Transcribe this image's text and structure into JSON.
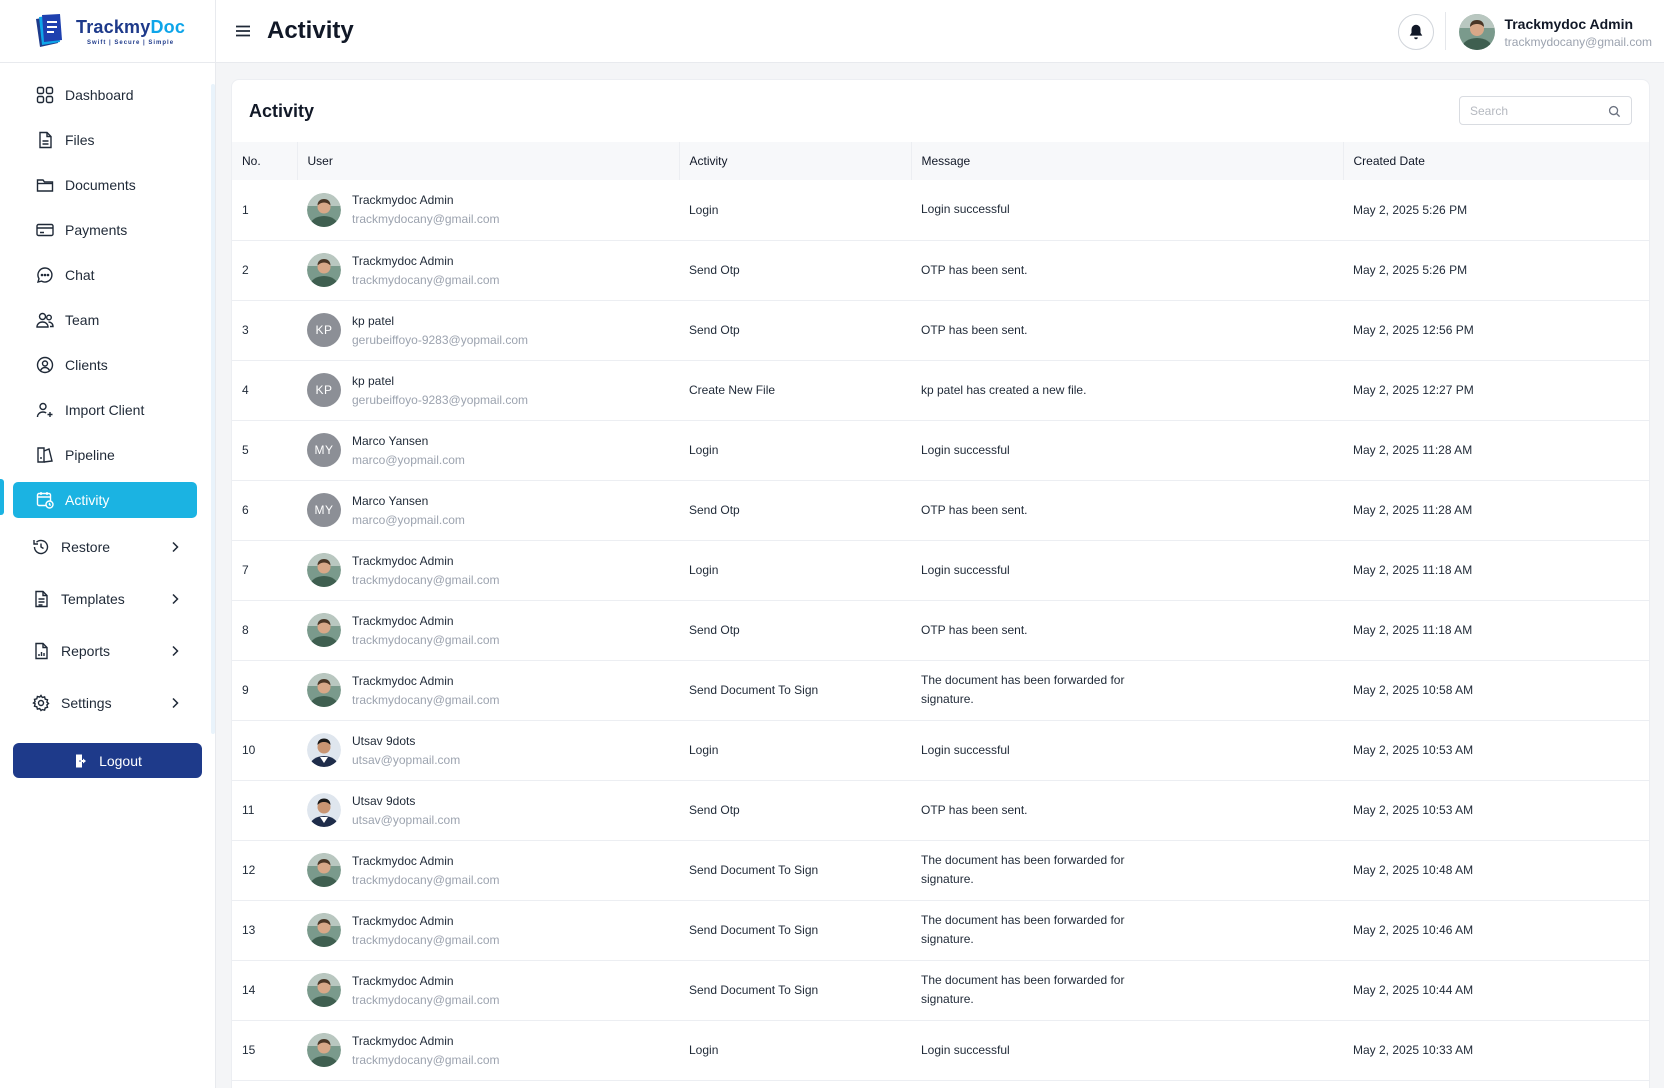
{
  "brand": {
    "name_part1": "Trackmy",
    "name_part2": "Doc",
    "tagline": "Swift | Secure | Simple"
  },
  "header": {
    "title": "Activity",
    "user_name": "Trackmydoc Admin",
    "user_email": "trackmydocany@gmail.com"
  },
  "nav": [
    {
      "label": "Dashboard",
      "icon": "grid-icon"
    },
    {
      "label": "Files",
      "icon": "file-icon"
    },
    {
      "label": "Documents",
      "icon": "folder-icon"
    },
    {
      "label": "Payments",
      "icon": "card-icon"
    },
    {
      "label": "Chat",
      "icon": "chat-icon"
    },
    {
      "label": "Team",
      "icon": "team-icon"
    },
    {
      "label": "Clients",
      "icon": "client-icon"
    },
    {
      "label": "Import Client",
      "icon": "user-add-icon"
    },
    {
      "label": "Pipeline",
      "icon": "pipeline-icon"
    },
    {
      "label": "Activity",
      "icon": "calendar-clock-icon",
      "active": true
    }
  ],
  "nav_groups": [
    {
      "label": "Restore",
      "icon": "history-icon"
    },
    {
      "label": "Templates",
      "icon": "template-icon"
    },
    {
      "label": "Reports",
      "icon": "report-icon"
    },
    {
      "label": "Settings",
      "icon": "gear-icon"
    }
  ],
  "logout_label": "Logout",
  "card": {
    "title": "Activity",
    "search_placeholder": "Search"
  },
  "table": {
    "columns": [
      "No.",
      "User",
      "Activity",
      "Message",
      "Created Date"
    ],
    "rows": [
      {
        "no": "1",
        "name": "Trackmydoc Admin",
        "email": "trackmydocany@gmail.com",
        "avatar": "photo-admin",
        "activity": "Login",
        "message": "Login successful",
        "date": "May 2, 2025 5:26 PM"
      },
      {
        "no": "2",
        "name": "Trackmydoc Admin",
        "email": "trackmydocany@gmail.com",
        "avatar": "photo-admin",
        "activity": "Send Otp",
        "message": "OTP has been sent.",
        "date": "May 2, 2025 5:26 PM"
      },
      {
        "no": "3",
        "name": "kp patel",
        "email": "gerubeiffoyo-9283@yopmail.com",
        "avatar": "KP",
        "activity": "Send Otp",
        "message": "OTP has been sent.",
        "date": "May 2, 2025 12:56 PM"
      },
      {
        "no": "4",
        "name": "kp patel",
        "email": "gerubeiffoyo-9283@yopmail.com",
        "avatar": "KP",
        "activity": "Create New File",
        "message": "kp patel has created a new file.",
        "date": "May 2, 2025 12:27 PM"
      },
      {
        "no": "5",
        "name": "Marco Yansen",
        "email": "marco@yopmail.com",
        "avatar": "MY",
        "activity": "Login",
        "message": "Login successful",
        "date": "May 2, 2025 11:28 AM"
      },
      {
        "no": "6",
        "name": "Marco Yansen",
        "email": "marco@yopmail.com",
        "avatar": "MY",
        "activity": "Send Otp",
        "message": "OTP has been sent.",
        "date": "May 2, 2025 11:28 AM"
      },
      {
        "no": "7",
        "name": "Trackmydoc Admin",
        "email": "trackmydocany@gmail.com",
        "avatar": "photo-admin",
        "activity": "Login",
        "message": "Login successful",
        "date": "May 2, 2025 11:18 AM"
      },
      {
        "no": "8",
        "name": "Trackmydoc Admin",
        "email": "trackmydocany@gmail.com",
        "avatar": "photo-admin",
        "activity": "Send Otp",
        "message": "OTP has been sent.",
        "date": "May 2, 2025 11:18 AM"
      },
      {
        "no": "9",
        "name": "Trackmydoc Admin",
        "email": "trackmydocany@gmail.com",
        "avatar": "photo-admin",
        "activity": "Send Document To Sign",
        "message": "The document has been forwarded for signature.",
        "date": "May 2, 2025 10:58 AM"
      },
      {
        "no": "10",
        "name": "Utsav 9dots",
        "email": "utsav@yopmail.com",
        "avatar": "photo-utsav",
        "activity": "Login",
        "message": "Login successful",
        "date": "May 2, 2025 10:53 AM"
      },
      {
        "no": "11",
        "name": "Utsav 9dots",
        "email": "utsav@yopmail.com",
        "avatar": "photo-utsav",
        "activity": "Send Otp",
        "message": "OTP has been sent.",
        "date": "May 2, 2025 10:53 AM"
      },
      {
        "no": "12",
        "name": "Trackmydoc Admin",
        "email": "trackmydocany@gmail.com",
        "avatar": "photo-admin",
        "activity": "Send Document To Sign",
        "message": "The document has been forwarded for signature.",
        "date": "May 2, 2025 10:48 AM"
      },
      {
        "no": "13",
        "name": "Trackmydoc Admin",
        "email": "trackmydocany@gmail.com",
        "avatar": "photo-admin",
        "activity": "Send Document To Sign",
        "message": "The document has been forwarded for signature.",
        "date": "May 2, 2025 10:46 AM"
      },
      {
        "no": "14",
        "name": "Trackmydoc Admin",
        "email": "trackmydocany@gmail.com",
        "avatar": "photo-admin",
        "activity": "Send Document To Sign",
        "message": "The document has been forwarded for signature.",
        "date": "May 2, 2025 10:44 AM"
      },
      {
        "no": "15",
        "name": "Trackmydoc Admin",
        "email": "trackmydocany@gmail.com",
        "avatar": "photo-admin",
        "activity": "Login",
        "message": "Login successful",
        "date": "May 2, 2025 10:33 AM"
      }
    ]
  },
  "colors": {
    "accent": "#1bb3e2",
    "brand_dark": "#1e3a8a",
    "initials_bg": "#8c8f96"
  }
}
